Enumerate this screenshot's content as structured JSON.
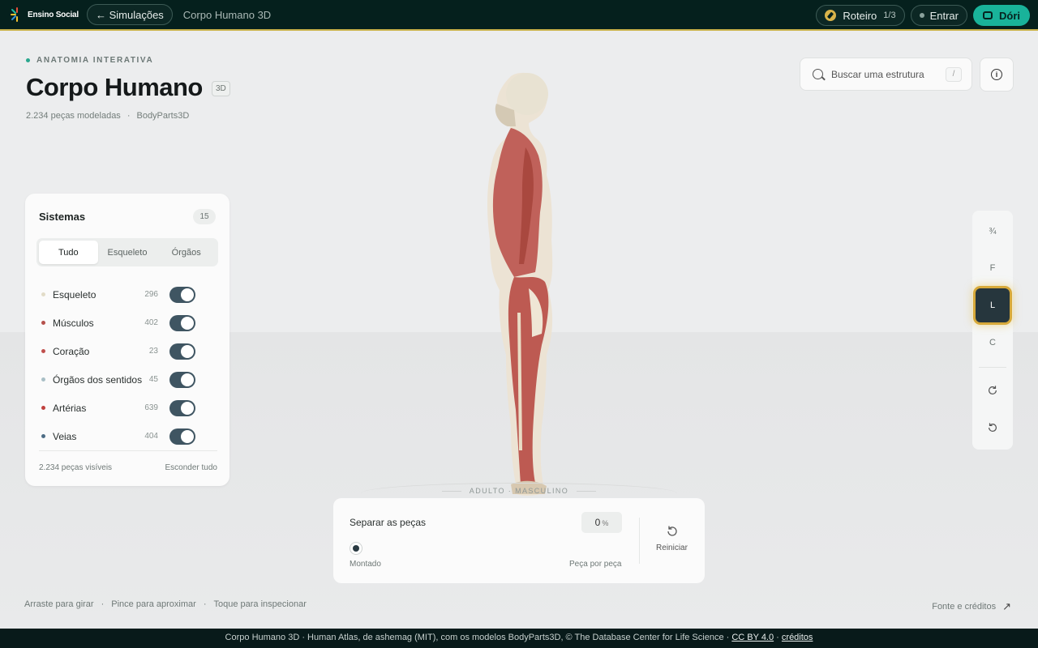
{
  "topbar": {
    "brand": "Ensino Social",
    "back_label": "← Simulações",
    "page_title": "Corpo Humano 3D",
    "tour_label": "Roteiro",
    "tour_count": "1/3",
    "login_label": "Entrar",
    "assistant_label": "Dóri"
  },
  "header": {
    "eyebrow": "ANATOMIA INTERATIVA",
    "title": "Corpo Humano",
    "badge": "3D",
    "pieces": "2.234 peças modeladas",
    "source": "BodyParts3D"
  },
  "search": {
    "placeholder": "Buscar uma estrutura",
    "shortcut": "/"
  },
  "systems": {
    "title": "Sistemas",
    "count": "15",
    "tabs": [
      "Tudo",
      "Esqueleto",
      "Órgãos"
    ],
    "active_tab": "Tudo",
    "items": [
      {
        "name": "Esqueleto",
        "count": "296",
        "color": "#e2dcc8",
        "on": true
      },
      {
        "name": "Músculos",
        "count": "402",
        "color": "#b5504c",
        "on": true
      },
      {
        "name": "Coração",
        "count": "23",
        "color": "#c0504d",
        "on": true
      },
      {
        "name": "Órgãos dos sentidos",
        "count": "45",
        "color": "#a9bfc6",
        "on": true
      },
      {
        "name": "Artérias",
        "count": "639",
        "color": "#c0413e",
        "on": true
      },
      {
        "name": "Veias",
        "count": "404",
        "color": "#4d6d85",
        "on": true
      }
    ],
    "visible": "2.234 peças visíveis",
    "hide_all": "Esconder tudo"
  },
  "model": {
    "label": "ADULTO · MASCULINO"
  },
  "view_rail": {
    "buttons": [
      "¾",
      "F",
      "L",
      "C"
    ],
    "active": "L",
    "accent": "#d7a93a"
  },
  "explode": {
    "label": "Separar as peças",
    "value": "0",
    "unit": "%",
    "min_label": "Montado",
    "max_label": "Peça por peça",
    "reset_label": "Reiniciar"
  },
  "hints": [
    "Arraste para girar",
    "Pince para aproximar",
    "Toque para inspecionar"
  ],
  "credits_link": "Fonte e créditos",
  "footer": {
    "text": "Corpo Humano 3D · Human Atlas, de ashemag (MIT), com os modelos BodyParts3D, © The Database Center for Life Science · ",
    "license": "CC BY 4.0",
    "dot": " · ",
    "credits": "créditos"
  }
}
